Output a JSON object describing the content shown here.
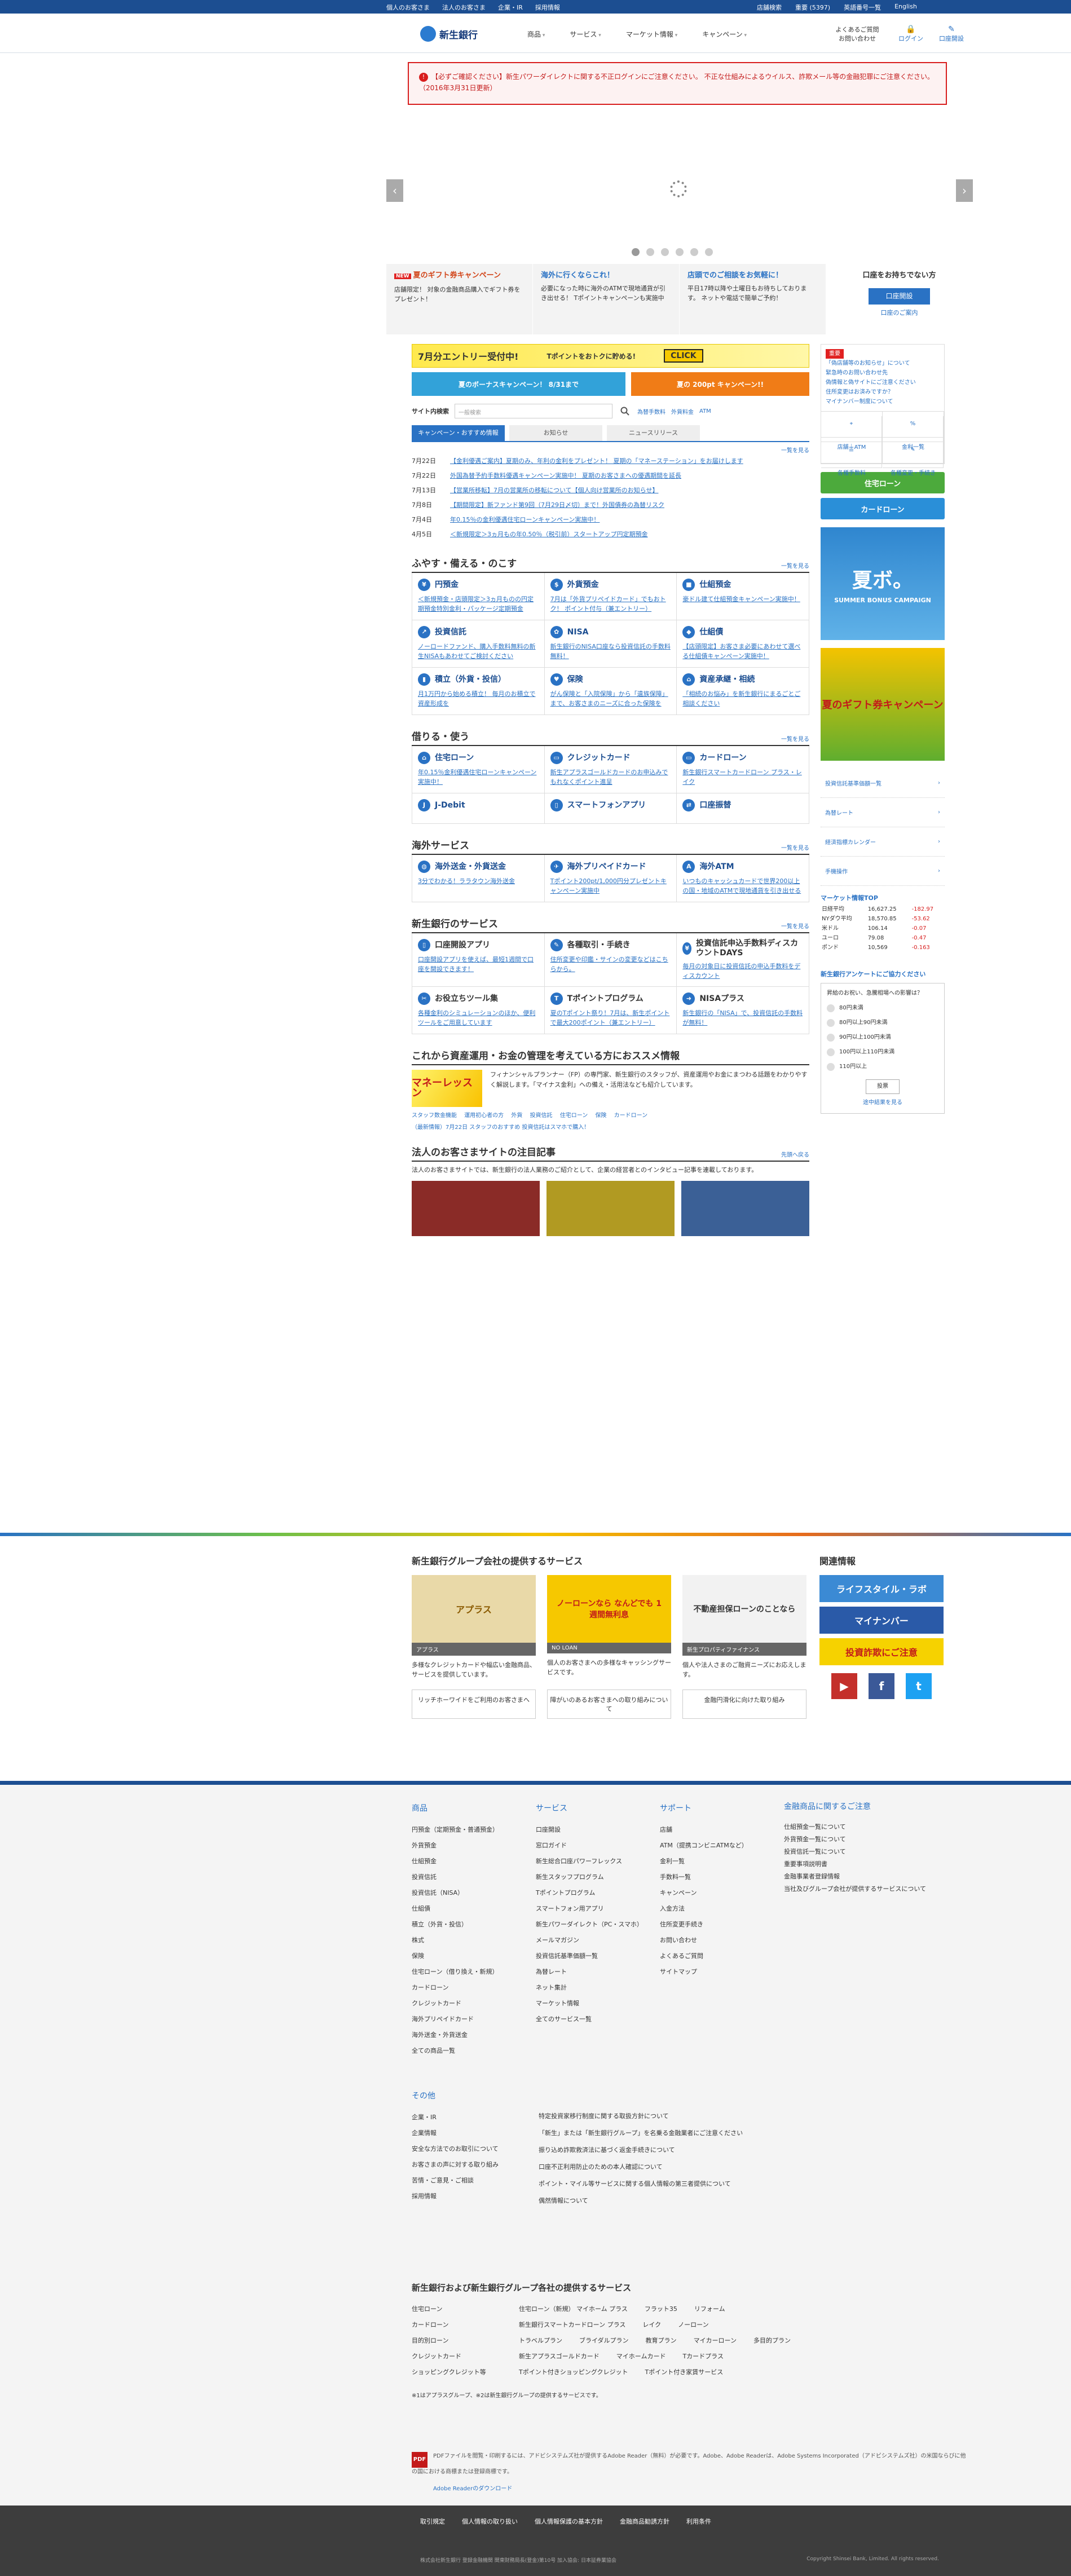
{
  "top": {
    "left": [
      "個人のお客さま",
      "法人のお客さま",
      "企業・IR",
      "採用情報"
    ],
    "right": [
      "店舗検索",
      "重要 (5397)",
      "英語番号一覧",
      "English"
    ]
  },
  "header": {
    "logo": "新生銀行",
    "menu": [
      "商品",
      "サービス",
      "マーケット情報",
      "キャンペーン"
    ],
    "faq": "よくあるご質問\nお問い合わせ",
    "login": "ログイン",
    "open": "口座開設"
  },
  "notice": "【必ずご確認ください】新生パワーダイレクトに関する不正ログインにご注意ください。 不正な仕組みによるウイルス、詐欺メール等の金融犯罪にご注意ください。（2016年3月31日更新）",
  "carousel": {
    "prev": "‹",
    "next": "›"
  },
  "promos": [
    {
      "title": "夏のギフト券キャンペーン",
      "text": "店舗限定！ 対象の金融商品購入でギフト券をプレゼント！"
    },
    {
      "title": "海外に行くならこれ！",
      "text": "必要になった時に海外のATMで現地通貨が引き出せる！ Tポイントキャンペーンも実施中"
    },
    {
      "title": "店頭でのご相談をお気軽に！",
      "text": "平日17時以降や土曜日もお待ちしております。 ネットや電話で簡単ご予約！"
    },
    {
      "title": "口座をお持ちでない方",
      "button": "口座開設",
      "link": "口座のご案内"
    }
  ],
  "banners": {
    "entry": "7月分エントリー受付中!",
    "entry_sub": "Tポイントをおトクに貯める!",
    "click": "CLICK",
    "bonus": "夏のボーナスキャンペーン！ 8/31まで",
    "summer": "夏の 200pt キャンペーン!!"
  },
  "search": {
    "label": "サイト内検索",
    "placeholder": "一般検索",
    "button": "検索",
    "links": [
      "為替手数料",
      "外貨料金",
      "ATM"
    ]
  },
  "tabs": [
    "キャンペーン・おすすめ情報",
    "お知らせ",
    "ニュースリリース"
  ],
  "more": "一覧を見る",
  "news": [
    {
      "date": "7月22日",
      "text": "【金利優遇ご案内】夏期のみ、年利の金利をプレゼント！ 夏期の「マネーステーション」をお届けします"
    },
    {
      "date": "7月22日",
      "text": "外国為替予約手数料優遇キャンペーン実施中！ 夏期のお客さまへの優遇期間を延長"
    },
    {
      "date": "7月13日",
      "text": "【営業所移転】7月の営業所の移転について【個人向け営業所のお知らせ】"
    },
    {
      "date": "7月8日",
      "text": "【期間限定】新ファンド第9回（7月29日〆切）まで！外国債券の為替リスク"
    },
    {
      "date": "7月4日",
      "text": "年0.15％の金利優遇住宅ローンキャンペーン実施中！"
    },
    {
      "date": "4月5日",
      "text": "＜新規限定＞3ヵ月もの年0.50％（税引前）スタートアップ円定期預金"
    }
  ],
  "sections": {
    "save": {
      "title": "ふやす・備える・のこす",
      "items": [
        {
          "name": "円預金",
          "text": "＜新規預金・店頭限定＞3ヵ月ものの円定期預金特別金利・パッケージ定期預金"
        },
        {
          "name": "外貨預金",
          "text": "7月は「外貨プリペイドカード」でもおトク！ ポイント付与（兼エントリー）"
        },
        {
          "name": "仕組預金",
          "text": "豪ドル建て仕組預金キャンペーン実施中！"
        },
        {
          "name": "投資信託",
          "text": "ノーロードファンド、購入手数料無料の新生NISAもあわせてご検討ください"
        },
        {
          "name": "NISA",
          "text": "新生銀行のNISA口座なら投資信託の手数料無料！"
        },
        {
          "name": "仕組債",
          "text": "【店頭限定】お客さま必要にあわせて選べる仕組債キャンペーン実施中！"
        },
        {
          "name": "積立（外貨・投信）",
          "text": "月1万円から始める積立！ 毎月のお積立で資産形成を"
        },
        {
          "name": "保険",
          "text": "がん保険と「入院保険」から「遺族保障」まで、お客さまのニーズに合った保険を"
        },
        {
          "name": "資産承継・相続",
          "text": "「相続のお悩み」を新生銀行にまるごとご相談ください"
        }
      ]
    },
    "borrow": {
      "title": "借りる・使う",
      "items": [
        {
          "name": "住宅ローン",
          "text": "年0.15％金利優遇住宅ローンキャンペーン実施中！"
        },
        {
          "name": "クレジットカード",
          "text": "新生アプラスゴールドカードのお申込みでもれなくポイント進呈"
        },
        {
          "name": "カードローン",
          "text": "新生銀行スマートカードローン プラス・レイク"
        },
        {
          "name": "J-Debit",
          "text": ""
        },
        {
          "name": "スマートフォンアプリ",
          "text": ""
        },
        {
          "name": "口座振替",
          "text": ""
        }
      ]
    },
    "overseas": {
      "title": "海外サービス",
      "items": [
        {
          "name": "海外送金・外貨送金",
          "text": "3分でわかる！ララタウン海外送金"
        },
        {
          "name": "海外プリペイドカード",
          "text": "Tポイント200pt/1,000円分プレゼントキャンペーン実施中"
        },
        {
          "name": "海外ATM",
          "text": "いつものキャッシュカードで世界200以上の国・地域のATMで現地通貨を引き出せる"
        }
      ]
    },
    "services": {
      "title": "新生銀行のサービス",
      "items": [
        {
          "name": "口座開設アプリ",
          "text": "口座開設アプリを使えば、最短1週間で口座を開設できます！"
        },
        {
          "name": "各種取引・手続き",
          "text": "住所変更や印鑑・サインの変更などはこちらから。"
        },
        {
          "name": "投資信託申込手数料ディスカウントDAYS",
          "text": "毎月の対象日に投資信託の申込手数料をディスカウント"
        },
        {
          "name": "お役立ちツール集",
          "text": "各種金利のシミュレーションのほか、便利ツールをご用意しています"
        },
        {
          "name": "Tポイントプログラム",
          "text": "夏のTポイント祭り！7月は、新生ポイントで最大200ポイント（兼エントリー）"
        },
        {
          "name": "NISAプラス",
          "text": "新生銀行の「NISA」で、投資信託の手数料が無料！"
        }
      ]
    }
  },
  "recommend": {
    "title": "これから資産運用・お金の管理を考えている方におススメ情報",
    "img": "マネーレッスン",
    "text": "フィナンシャルプランナー（FP）の専門家、新生銀行のスタッフが、資産運用やお金にまつわる話題をわかりやすく解説します。「マイナス金利」への備え・活用法なども紹介しています。",
    "links": [
      "スタッフ数金機能",
      "運用初心者の方",
      "外貨",
      "投資信託",
      "住宅ローン",
      "保険",
      "カードローン"
    ],
    "update": "（最新情報）7月22日 スタッフのおすすめ 投資信託はスマホで購入！"
  },
  "corporate": {
    "title": "法人のお客さまサイトの注目記事",
    "back": "先頭へ戻る",
    "text": "法人のお客さまサイトでは、新生銀行の法人業務のご紹介として、企業の経営者とのインタビュー記事を連載しております。",
    "photos": [
      "#8a2b27",
      "#b19a22",
      "#3b6096"
    ]
  },
  "side": {
    "notice_hd": "重要",
    "notice_links": [
      "「偽店舗等のお知らせ」について",
      "緊急時のお問い合わせ先",
      "偽情報と偽サイトにご注意ください",
      "住所変更はお済みですか？",
      "マイナンバー制度について"
    ],
    "icons": [
      "店舗｜ATM",
      "金利一覧",
      "各種手数料",
      "各種変更・手続き"
    ],
    "btn1": "住宅ローン",
    "btn2": "カードローン",
    "banner1": "夏ボ。",
    "banner1_sub": "SUMMER BONUS CAMPAIGN",
    "banner2": "夏のギフト券キャンペーン",
    "links": [
      "投資信託基準価額一覧",
      "為替レート",
      "経済指標カレンダー",
      "手機操作",
      "マーケット情報"
    ],
    "market_title": "マーケット情報TOP",
    "market": [
      [
        "日経平均",
        "16,627.25",
        "-182.97"
      ],
      [
        "NYダウ平均",
        "18,570.85",
        "-53.62"
      ],
      [
        "米ドル",
        "106.14",
        "-0.07"
      ],
      [
        "ユーロ",
        "79.08",
        "-0.47"
      ],
      [
        "ポンド",
        "10,569",
        "-0.163"
      ]
    ],
    "poll_title": "新生銀行アンケートにご協力ください",
    "poll_q": "昇給のお祝い、急騰相場への影響は？",
    "poll_opts": [
      "80円未満",
      "80円以上90円未満",
      "90円以上100円未満",
      "100円以上110円未満",
      "110円以上"
    ],
    "poll_vote": "投票",
    "poll_result": "途中結果を見る"
  },
  "group": {
    "title": "新生銀行グループ会社の提供するサービス",
    "cards": [
      {
        "name": "アプラス",
        "img": "アプラス",
        "text": "多様なクレジットカードや幅広い金融商品、サービスを提供しています。"
      },
      {
        "name": "NO LOAN",
        "img": "ノーローンなら なんどでも 1週間無利息",
        "text": "個人のお客さまへの多様なキャッシングサービスです。"
      },
      {
        "name": "新生プロパティファイナンス",
        "img": "不動産担保ローンのことなら",
        "text": "個人や法人さまのご融資ニーズにお応えします。"
      }
    ],
    "links": [
      "リッチホーワイドをご利用のお客さまへ",
      "障がいのあるお客さまへの取り組みについて",
      "金融円滑化に向けた取り組み"
    ]
  },
  "related": {
    "title": "関連情報",
    "banners": [
      "ライフスタイル・ラボ",
      "マイナンバー",
      "投資詐欺にご注意"
    ],
    "social": [
      "▶",
      "f",
      "t"
    ]
  },
  "footer": {
    "cols": [
      {
        "title": "商品",
        "items": [
          "円預金（定期預金・普通預金）",
          "外貨預金",
          "仕組預金",
          "投資信託",
          "投資信託（NISA）",
          "仕組債",
          "積立（外貨・投信）",
          "株式",
          "保険",
          "住宅ローン（借り換え・新規）",
          "カードローン",
          "クレジットカード",
          "海外プリペイドカード",
          "海外送金・外貨送金",
          "全ての商品一覧"
        ]
      },
      {
        "title": "サービス",
        "items": [
          "口座開設",
          "窓口ガイド",
          "新生総合口座パワーフレックス",
          "新生スタッフプログラム",
          "Tポイントプログラム",
          "スマートフォン用アプリ",
          "新生パワーダイレクト（PC・スマホ）",
          "メールマガジン",
          "投資信託基準価額一覧",
          "為替レート",
          "ネット集計",
          "マーケット情報",
          "全てのサービス一覧"
        ]
      },
      {
        "title": "サポート",
        "items": [
          "店舗",
          "ATM（提携コンビニATMなど）",
          "金利一覧",
          "手数料一覧",
          "キャンペーン",
          "入金方法",
          "住所変更手続き",
          "お問い合わせ",
          "よくあるご質問",
          "サイトマップ"
        ]
      },
      {
        "title": "金融商品に関するご注意",
        "items": [
          "仕組預金一覧について",
          "外貨預金一覧について",
          "投資信託一覧について",
          "重要事項説明書",
          "金融事業者登録情報",
          "当社及びグループ会社が提供するサービスについて"
        ]
      }
    ],
    "other_title": "その他",
    "other": [
      "企業・IR",
      "企業情報",
      "安全な方法でのお取引について",
      "お客さまの声に対する取り組み",
      "苦情・ご意見・ご相談",
      "採用情報"
    ],
    "other2": [
      "特定投資家移行制度に関する取扱方針について",
      "「新生」または「新生銀行グループ」を名乗る金融業者にご注意ください",
      "振り込め詐欺救済法に基づく返金手続きについて",
      "口座不正利用防止のための本人確認について",
      "ポイント・マイル等サービスに関する個人情報の第三者提供について",
      "偶然情報について"
    ],
    "group_title": "新生銀行および新生銀行グループ各社の提供するサービス",
    "group_rows": [
      [
        "住宅ローン",
        "住宅ローン（新規） マイホーム プラス",
        "フラット35",
        "リフォーム"
      ],
      [
        "カードローン",
        "新生銀行スマートカードローン プラス",
        "レイク",
        "ノーローン"
      ],
      [
        "目的別ローン",
        "トラベルプラン",
        "ブライダルプラン",
        "教育プラン",
        "マイカーローン",
        "多目的プラン"
      ],
      [
        "クレジットカード",
        "新生アプラスゴールドカード",
        "マイホームカード",
        "Tカードプラス"
      ],
      [
        "ショッピングクレジット等",
        "Tポイント付きショッピングクレジット",
        "Tポイント付き家賃サービス"
      ]
    ],
    "group_note": "※1はアプラスグループ、※2は新生銀行グループの提供するサービスです。",
    "adobe_icon": "PDF",
    "adobe": "PDFファイルを閲覧・印刷するには、アドビシステムズ社が提供するAdobe Reader（無料）が必要です。Adobe、Adobe Readerは、Adobe Systems Incorporated（アドビシステムズ社）の米国ならびに他の国における商標または登録商標です。",
    "adobe_link": "Adobe Readerのダウンロード"
  },
  "bottom": {
    "links": [
      "取引規定",
      "個人情報の取り扱い",
      "個人情報保護の基本方針",
      "金融商品勧誘方針",
      "利用条件"
    ],
    "copy_left": "株式会社新生銀行 登録金融機関 関東財務局長(登金)第10号 加入協会: 日本証券業協会",
    "copy_right": "Copyright Shinsei Bank, Limited. All rights reserved."
  },
  "colors": {
    "brand": "#1c4e91",
    "accent": "#2a72c4",
    "red": "#d81e1e",
    "green": "#4caa3c"
  }
}
